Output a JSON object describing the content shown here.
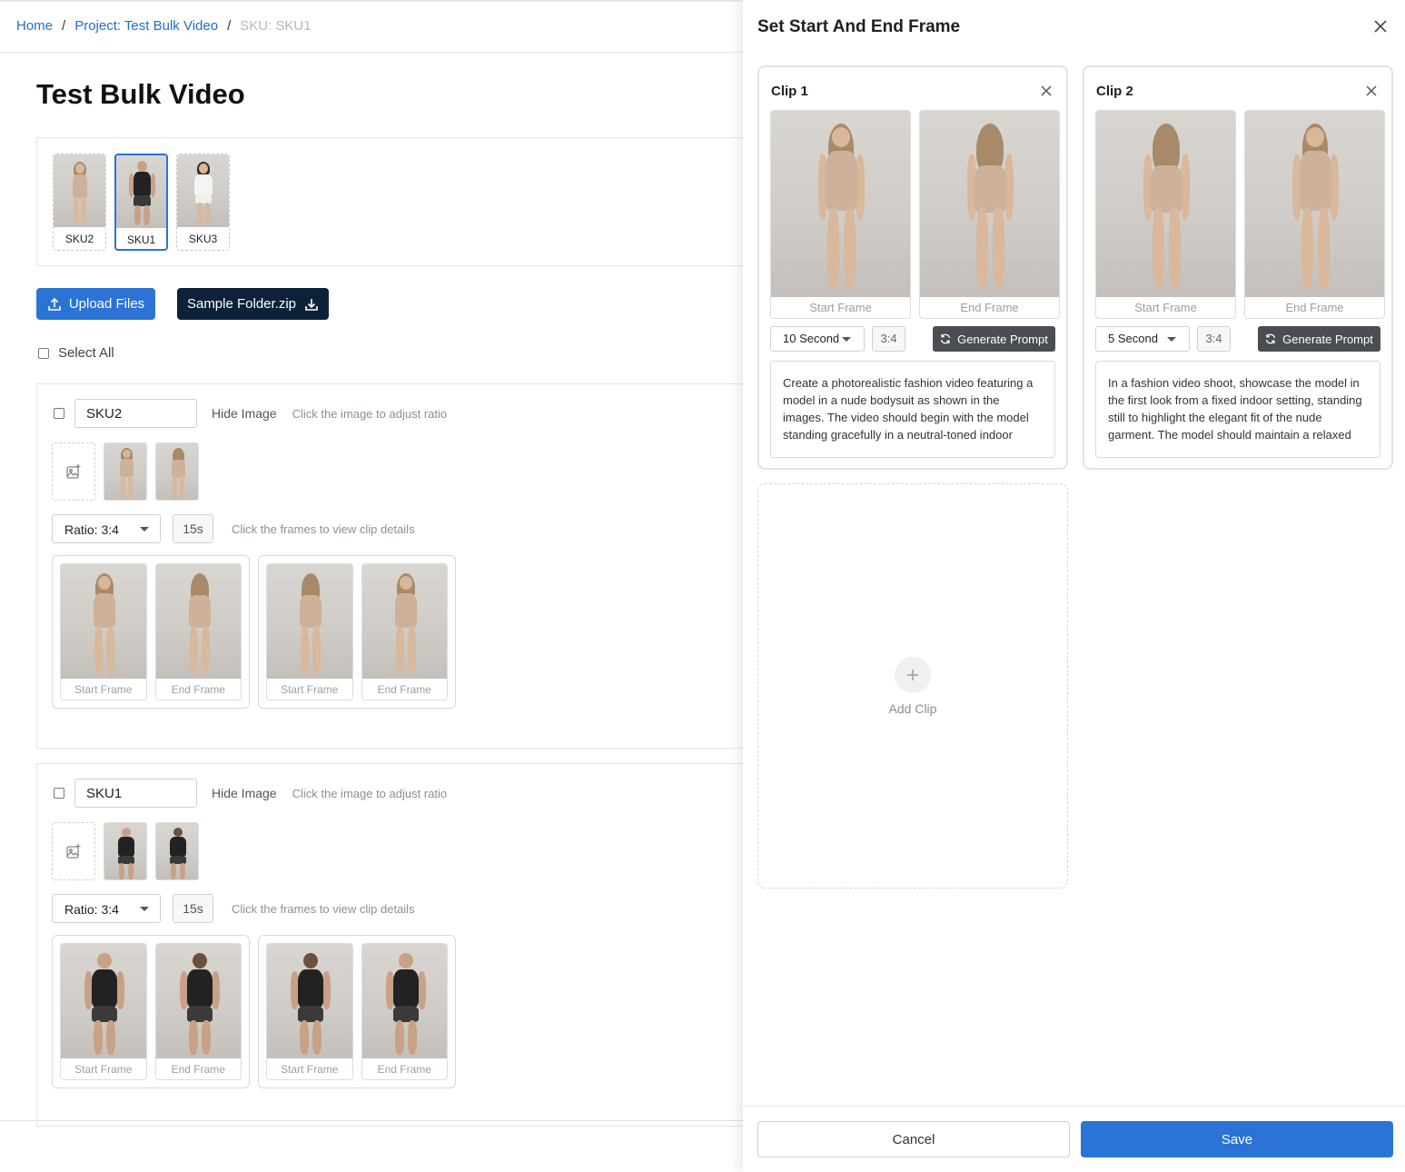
{
  "breadcrumb": {
    "home": "Home",
    "project": "Project: Test Bulk Video",
    "current": "SKU: SKU1",
    "separator": "/"
  },
  "page": {
    "title": "Test Bulk Video"
  },
  "sku_strip": [
    {
      "label": "SKU2"
    },
    {
      "label": "SKU1"
    },
    {
      "label": "SKU3"
    }
  ],
  "actions": {
    "upload": "Upload Files",
    "sample": "Sample Folder.zip",
    "select_all": "Select All"
  },
  "sku_cards": [
    {
      "name": "SKU2",
      "hide_image": "Hide Image",
      "hint": "Click the image to adjust ratio",
      "ratio": "Ratio: 3:4",
      "duration": "15s",
      "clip_hint": "Click the frames to view clip details",
      "start_label": "Start Frame",
      "end_label": "End Frame"
    },
    {
      "name": "SKU1",
      "hide_image": "Hide Image",
      "hint": "Click the image to adjust ratio",
      "ratio": "Ratio: 3:4",
      "duration": "15s",
      "clip_hint": "Click the frames to view clip details",
      "start_label": "Start Frame",
      "end_label": "End Frame"
    }
  ],
  "drawer": {
    "title": "Set Start And End Frame",
    "clips": [
      {
        "title": "Clip 1",
        "start_label": "Start Frame",
        "end_label": "End Frame",
        "seconds": "10 Second",
        "aspect": "3:4",
        "generate": "Generate Prompt",
        "prompt": "Create a photorealistic fashion video featuring a model in a nude bodysuit as shown in the images. The video should begin with the model standing gracefully in a neutral-toned indoor"
      },
      {
        "title": "Clip 2",
        "start_label": "Start Frame",
        "end_label": "End Frame",
        "seconds": "5 Second",
        "aspect": "3:4",
        "generate": "Generate Prompt",
        "prompt": "In a fashion video shoot, showcase the model in the first look from a fixed indoor setting, standing still to highlight the elegant fit of the nude garment. The model should maintain a relaxed"
      }
    ],
    "add_clip": "Add Clip",
    "cancel": "Cancel",
    "save": "Save"
  },
  "colors": {
    "primary": "#2b74d6",
    "dark_button": "#0d2238",
    "link": "#1a6fd1",
    "generate_button": "#4a4d52"
  }
}
